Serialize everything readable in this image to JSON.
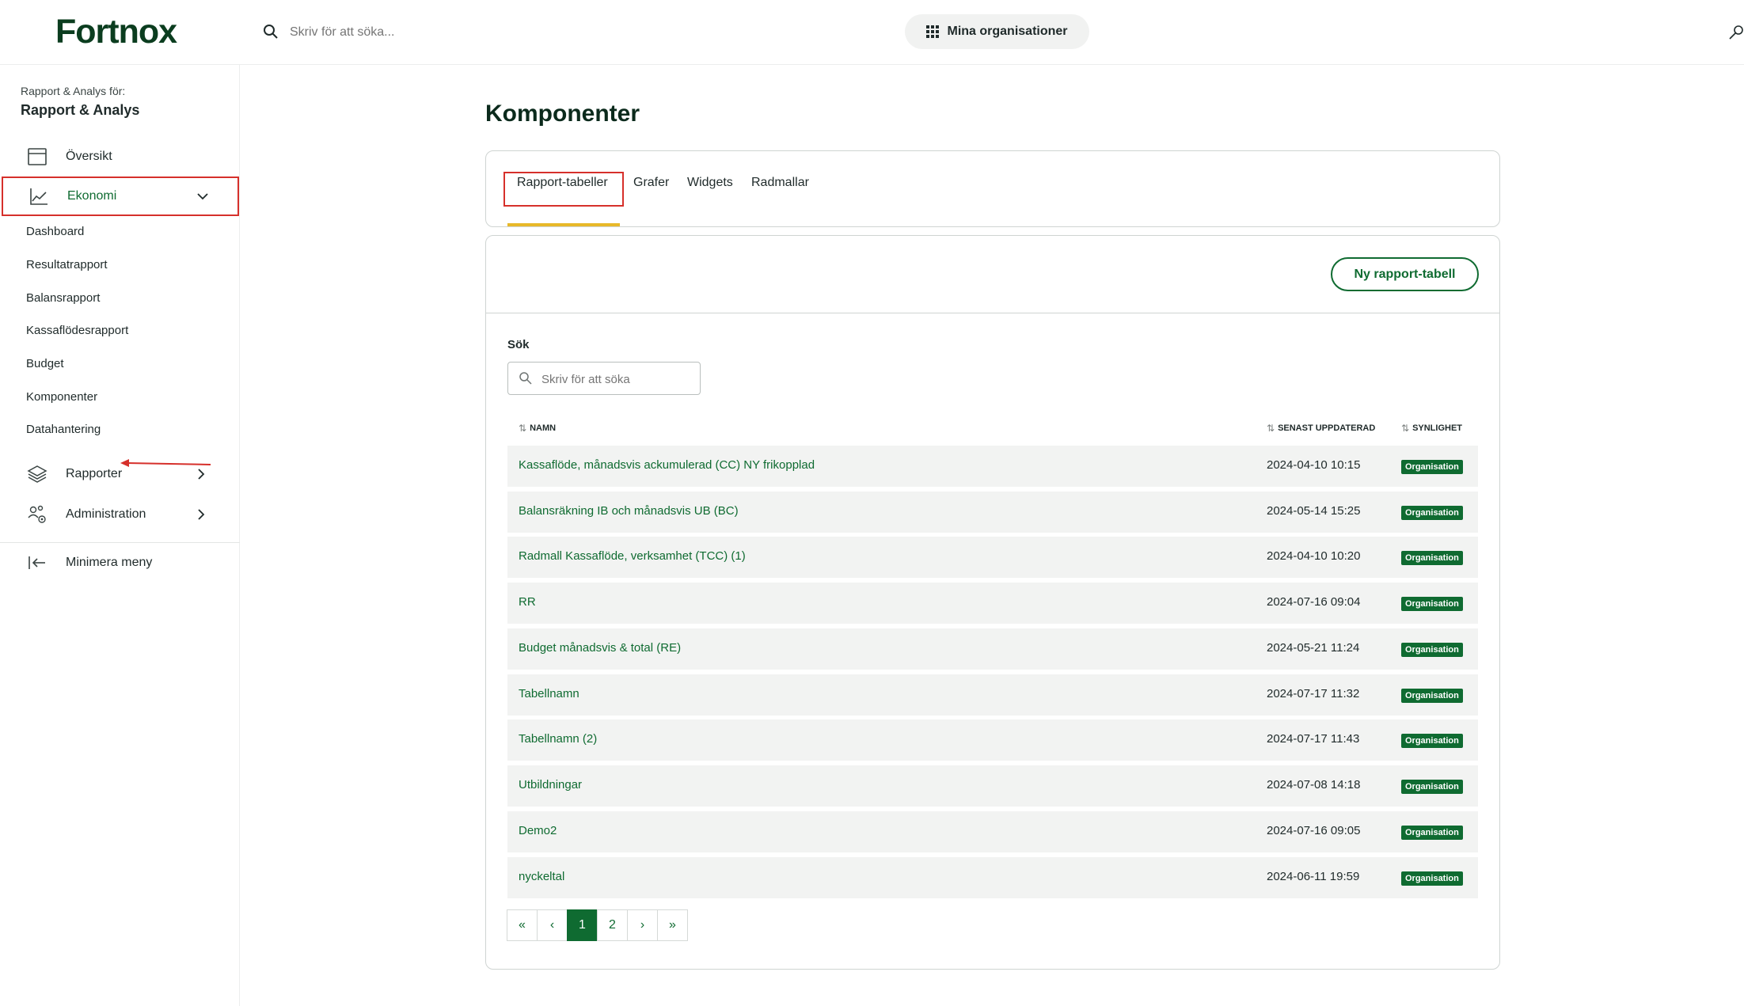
{
  "header": {
    "logo": "Fortnox",
    "search_placeholder": "Skriv för att söka...",
    "orgs_label": "Mina organisationer"
  },
  "sidebar": {
    "subtitle": "Rapport & Analys för:",
    "title": "Rapport & Analys",
    "overview": "Översikt",
    "economy": "Ekonomi",
    "sub_items": [
      "Dashboard",
      "Resultatrapport",
      "Balansrapport",
      "Kassaflödesrapport",
      "Budget",
      "Komponenter",
      "Datahantering"
    ],
    "reports": "Rapporter",
    "administration": "Administration",
    "minimize": "Minimera meny"
  },
  "main": {
    "title": "Komponenter",
    "tabs": [
      "Rapport-tabeller",
      "Grafer",
      "Widgets",
      "Radmallar"
    ],
    "new_button": "Ny rapport-tabell",
    "search_label": "Sök",
    "search_placeholder": "Skriv för att söka",
    "columns": {
      "name": "NAMN",
      "updated": "SENAST UPPDATERAD",
      "visibility": "SYNLIGHET"
    },
    "rows": [
      {
        "name": "Kassaflöde, månadsvis ackumulerad (CC) NY frikopplad",
        "updated": "2024-04-10 10:15",
        "visibility": "Organisation"
      },
      {
        "name": "Balansräkning IB och månadsvis UB (BC)",
        "updated": "2024-05-14 15:25",
        "visibility": "Organisation"
      },
      {
        "name": "Radmall Kassaflöde, verksamhet (TCC) (1)",
        "updated": "2024-04-10 10:20",
        "visibility": "Organisation"
      },
      {
        "name": "RR",
        "updated": "2024-07-16 09:04",
        "visibility": "Organisation"
      },
      {
        "name": "Budget månadsvis & total (RE)",
        "updated": "2024-05-21 11:24",
        "visibility": "Organisation"
      },
      {
        "name": "Tabellnamn",
        "updated": "2024-07-17 11:32",
        "visibility": "Organisation"
      },
      {
        "name": "Tabellnamn (2)",
        "updated": "2024-07-17 11:43",
        "visibility": "Organisation"
      },
      {
        "name": "Utbildningar",
        "updated": "2024-07-08 14:18",
        "visibility": "Organisation"
      },
      {
        "name": "Demo2",
        "updated": "2024-07-16 09:05",
        "visibility": "Organisation"
      },
      {
        "name": "nyckeltal",
        "updated": "2024-06-11 19:59",
        "visibility": "Organisation"
      }
    ],
    "pagination": {
      "first": "«",
      "prev": "‹",
      "pages": [
        "1",
        "2"
      ],
      "next": "›",
      "last": "»"
    }
  },
  "colors": {
    "brand_green": "#0f6b31",
    "highlight_red": "#d6302b",
    "tab_underline": "#e8b92a"
  }
}
